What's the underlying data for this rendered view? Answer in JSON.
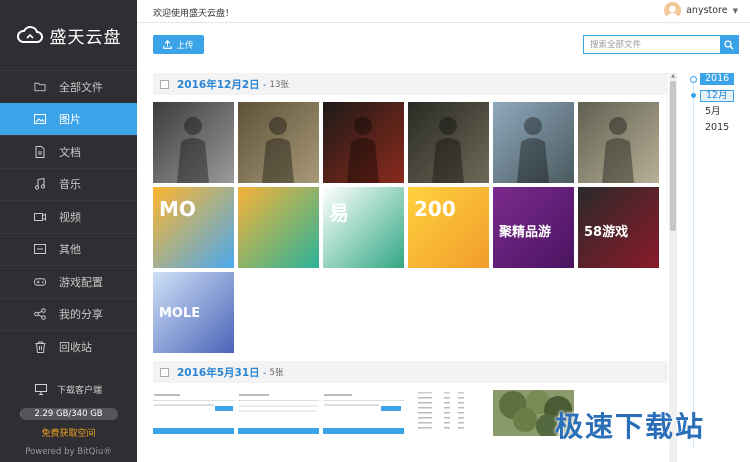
{
  "app": {
    "brand_name": "盛天云盘",
    "welcome": "欢迎使用盛天云盘！",
    "username": "anystore"
  },
  "colors": {
    "accent": "#3ba3e8",
    "sidebar_bg": "#2f2f33",
    "date_text": "#2a86d4",
    "free_space": "#f0a020"
  },
  "sidebar": {
    "items": [
      {
        "label": "全部文件",
        "icon": "folder-icon"
      },
      {
        "label": "图片",
        "icon": "image-icon",
        "active": true
      },
      {
        "label": "文档",
        "icon": "document-icon"
      },
      {
        "label": "音乐",
        "icon": "music-icon"
      },
      {
        "label": "视频",
        "icon": "video-icon"
      },
      {
        "label": "其他",
        "icon": "other-icon"
      },
      {
        "label": "游戏配置",
        "icon": "gamepad-icon"
      },
      {
        "label": "我的分享",
        "icon": "share-icon"
      },
      {
        "label": "回收站",
        "icon": "trash-icon"
      }
    ],
    "download_client": "下载客户端",
    "quota_text": "2.29 GB/340 GB",
    "quota_used_fraction": 0.0067,
    "free_space_link": "免费获取空间",
    "powered_by": "Powered by BitQiu®"
  },
  "toolbar": {
    "upload_label": "上传",
    "search_placeholder": "搜索全部文件"
  },
  "groups": [
    {
      "date": "2016年12月2日",
      "count": "13张",
      "thumbs": [
        {
          "name": "soldier-gasmask",
          "c1": "#3c3c3c",
          "c2": "#9a9a9a"
        },
        {
          "name": "lara-croft-1",
          "c1": "#5e5138",
          "c2": "#a89a78"
        },
        {
          "name": "action-hero-red",
          "c1": "#1e1a18",
          "c2": "#8a2a1c"
        },
        {
          "name": "soldier-helmet",
          "c1": "#2a2a24",
          "c2": "#6e6a58"
        },
        {
          "name": "soldiers-field",
          "c1": "#8fa9bd",
          "c2": "#4a5a5e"
        },
        {
          "name": "lara-croft-2",
          "c1": "#606050",
          "c2": "#b8b098"
        },
        {
          "name": "mole-game",
          "c1": "#ffb52e",
          "c2": "#4aa9ee",
          "text": "MO"
        },
        {
          "name": "y-logo",
          "c1": "#f5b236",
          "c2": "#2bb39a"
        },
        {
          "name": "yixun-logo",
          "c1": "#ffffff",
          "c2": "#31a884",
          "text": "易"
        },
        {
          "name": "folder-cloud",
          "c1": "#ffd23f",
          "c2": "#f19c2a",
          "text": "200"
        },
        {
          "name": "yilewan",
          "c1": "#7b2a8e",
          "c2": "#4a1460",
          "text": "聚精品游"
        },
        {
          "name": "58-games",
          "c1": "#2a2a2a",
          "c2": "#8a1a2a",
          "text": "58游戏"
        },
        {
          "name": "mole-anime",
          "c1": "#cfe1f7",
          "c2": "#4a64b8",
          "text": "MOLE"
        }
      ]
    },
    {
      "date": "2016年5月31日",
      "count": "5张"
    }
  ],
  "timeline": {
    "years": [
      "2016",
      "12月",
      "5月",
      "2015"
    ]
  },
  "watermark": "极速下载站"
}
